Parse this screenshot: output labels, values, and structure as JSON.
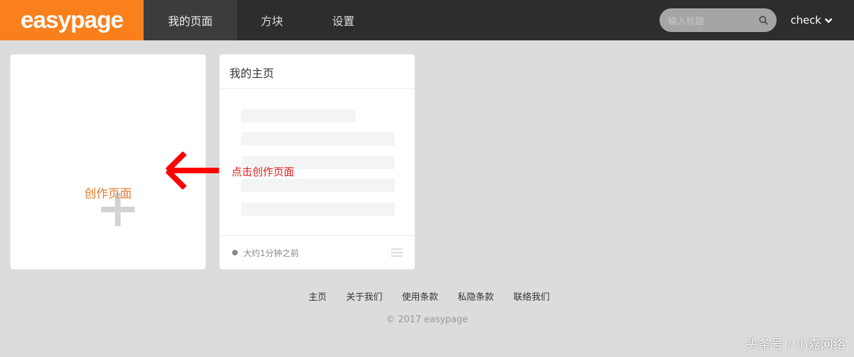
{
  "header": {
    "logo": "easypage",
    "nav": [
      "我的页面",
      "方块",
      "设置"
    ],
    "search_placeholder": "输入标题",
    "user": "check"
  },
  "create_card": {
    "label": "创作页面"
  },
  "page_card": {
    "title": "我的主页",
    "time": "大约1分钟之前"
  },
  "annotation": "点击创作页面",
  "footer": {
    "links": [
      "主页",
      "关于我们",
      "使用条款",
      "私隐条款",
      "联络我们"
    ],
    "copyright": "© 2017 easypage"
  },
  "watermark": "头条号 / 小嘉网络"
}
